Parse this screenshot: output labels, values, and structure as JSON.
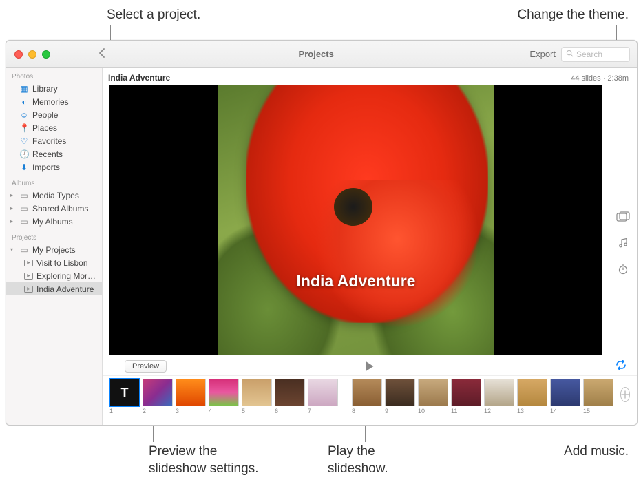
{
  "callouts": {
    "select_project": "Select a project.",
    "change_theme": "Change the theme.",
    "preview_settings_l1": "Preview the",
    "preview_settings_l2": "slideshow settings.",
    "play_l1": "Play the",
    "play_l2": "slideshow.",
    "add_music": "Add music."
  },
  "titlebar": {
    "title": "Projects",
    "export": "Export",
    "search_placeholder": "Search"
  },
  "sidebar": {
    "sections": {
      "photos": "Photos",
      "albums": "Albums",
      "projects": "Projects"
    },
    "photos_items": {
      "library": "Library",
      "memories": "Memories",
      "people": "People",
      "places": "Places",
      "favorites": "Favorites",
      "recents": "Recents",
      "imports": "Imports"
    },
    "albums_items": {
      "media_types": "Media Types",
      "shared_albums": "Shared Albums",
      "my_albums": "My Albums"
    },
    "projects_items": {
      "my_projects": "My Projects",
      "visit_lisbon": "Visit to Lisbon",
      "exploring": "Exploring Mor…",
      "india": "India Adventure"
    }
  },
  "project": {
    "title": "India Adventure",
    "meta": "44 slides · 2:38m",
    "overlay_title": "India Adventure"
  },
  "controls": {
    "preview": "Preview"
  },
  "thumbs": [
    "1",
    "2",
    "3",
    "4",
    "5",
    "6",
    "7",
    "8",
    "9",
    "10",
    "11",
    "12",
    "13",
    "14",
    "15"
  ],
  "title_thumb": "T"
}
